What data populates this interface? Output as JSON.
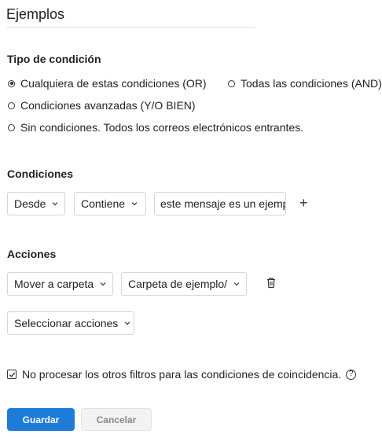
{
  "rule": {
    "name": "Ejemplos"
  },
  "condition_type": {
    "title": "Tipo de condición",
    "options": [
      {
        "label": "Cualquiera de estas condiciones (OR)",
        "selected": true
      },
      {
        "label": "Todas las condiciones (AND)",
        "selected": false
      },
      {
        "label": "Condiciones avanzadas (Y/O BIEN)",
        "selected": false
      },
      {
        "label": "Sin condiciones. Todos los correos electrónicos entrantes.",
        "selected": false
      }
    ]
  },
  "conditions": {
    "title": "Condiciones",
    "field": "Desde",
    "operator": "Contiene",
    "value": "este mensaje es un ejemp",
    "add_symbol": "+"
  },
  "actions": {
    "title": "Acciones",
    "action": "Mover a carpeta",
    "target": "Carpeta de ejemplo/",
    "select_placeholder": "Seleccionar acciones"
  },
  "stop_processing": {
    "label": "No procesar los otros filtros para las condiciones de coincidencia.",
    "checked": true,
    "help_symbol": "?"
  },
  "buttons": {
    "save": "Guardar",
    "cancel": "Cancelar"
  },
  "colors": {
    "primary": "#1f7bd8",
    "border": "#d5d5d5",
    "text": "#222222"
  }
}
